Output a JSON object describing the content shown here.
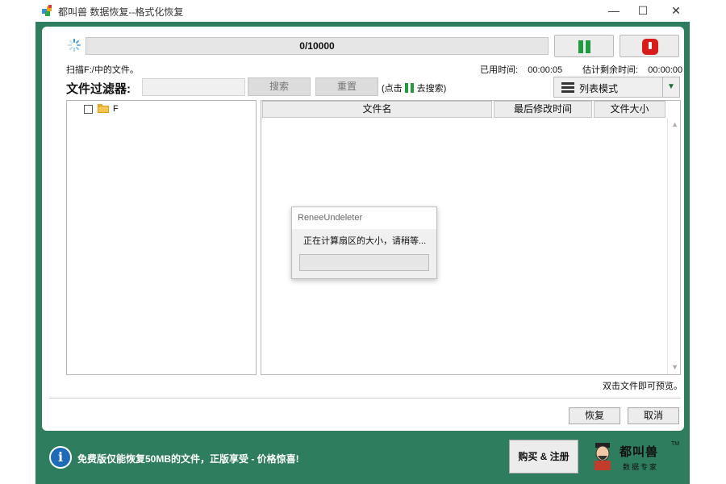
{
  "window": {
    "title": "都叫兽 数据恢复--格式化恢复",
    "minimize": "—",
    "maximize": "☐",
    "close": "✕"
  },
  "scan": {
    "progress_text": "0/10000",
    "status": "扫描F:/中的文件。",
    "elapsed_label": "已用时间:",
    "elapsed_value": "00:00:05",
    "remaining_label": "估计剩余时间:",
    "remaining_value": "00:00:00"
  },
  "filter": {
    "label": "文件过滤器:",
    "input_value": "",
    "search_label": "搜索",
    "reset_label": "重置",
    "hint_prefix": "(点击",
    "hint_suffix": "去搜索)",
    "view_mode": "列表模式"
  },
  "tree": {
    "items": [
      {
        "label": "F"
      }
    ]
  },
  "file_list": {
    "columns": [
      "文件名",
      "最后修改时间",
      "文件大小"
    ]
  },
  "preview_hint": "双击文件即可预览。",
  "buttons": {
    "recover": "恢复",
    "cancel": "取消"
  },
  "dialog": {
    "title": "ReneeUndeleter",
    "message": "正在计算扇区的大小，请稍等..."
  },
  "banner": {
    "text": "免费版仅能恢复50MB的文件，正版享受 - 价格惊喜!",
    "buy_label": "购买 & 注册",
    "logo_name": "都叫兽",
    "logo_sub": "数据专家",
    "logo_tm": "TM"
  },
  "colors": {
    "frame_green": "#2e7d5e",
    "pause_green": "#1f9a3e",
    "stop_red": "#d81b1b",
    "info_blue": "#1e6bb8"
  },
  "icons": [
    "app-icon",
    "spinner-icon",
    "pause-icon",
    "stop-icon",
    "list-view-icon",
    "folder-icon",
    "info-icon",
    "logo-face-icon"
  ]
}
